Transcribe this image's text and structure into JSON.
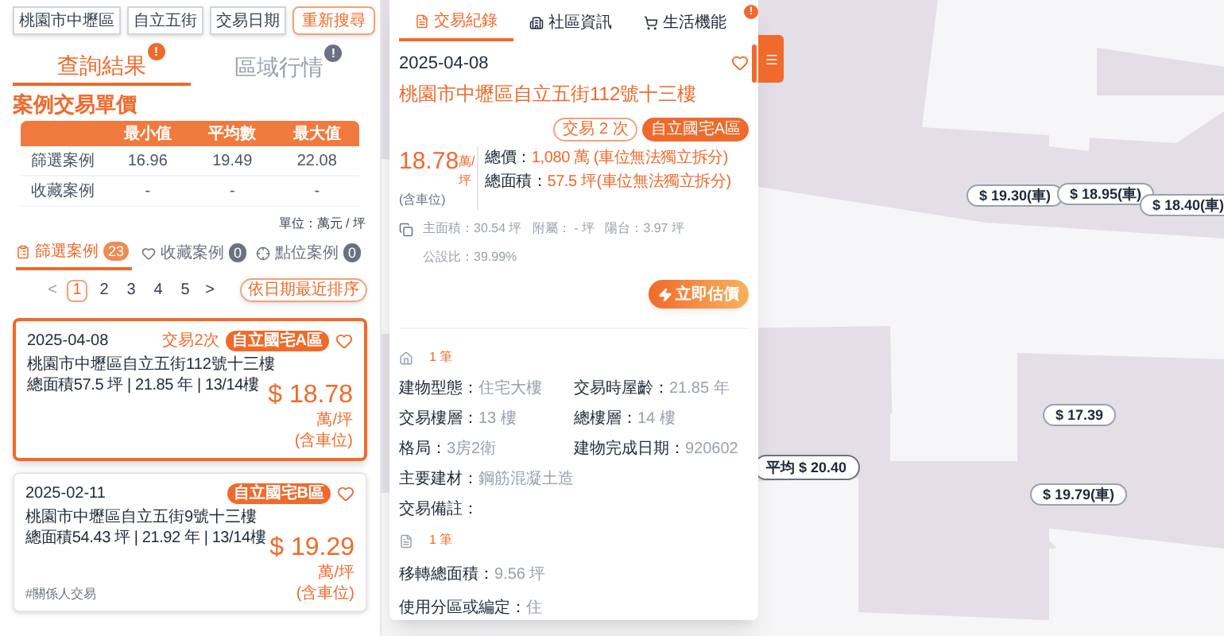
{
  "filters": {
    "chips": [
      "桃園市中壢區",
      "自立五街",
      "交易日期"
    ],
    "search_button": "重新搜尋"
  },
  "result_tabs": [
    {
      "label": "查詢結果",
      "selected": true,
      "badge": "!"
    },
    {
      "label": "區域行情",
      "selected": false,
      "badge": "!"
    }
  ],
  "price_table": {
    "title": "案例交易單價",
    "columns": [
      "最小值",
      "平均數",
      "最大值"
    ],
    "rows": [
      {
        "label": "篩選案例",
        "values": [
          "16.96",
          "19.49",
          "22.08"
        ]
      },
      {
        "label": "收藏案例",
        "values": [
          "-",
          "-",
          "-"
        ]
      }
    ],
    "unit": "單位：萬元 / 坪"
  },
  "case_tabs": [
    {
      "label": "篩選案例",
      "count": "23",
      "selected": true
    },
    {
      "label": "收藏案例",
      "count": "0",
      "selected": false
    },
    {
      "label": "點位案例",
      "count": "0",
      "selected": false
    }
  ],
  "pagination": {
    "prev": "<",
    "pages": [
      {
        "label": "1",
        "selected": true
      },
      {
        "label": "2",
        "selected": false
      },
      {
        "label": "3",
        "selected": false
      },
      {
        "label": "4",
        "selected": false
      },
      {
        "label": "5",
        "selected": false
      }
    ],
    "next": ">",
    "sort_button": "依日期最近排序"
  },
  "cases": [
    {
      "date": "2025-04-08",
      "trades": "交易2次",
      "tag": "自立國宅A區",
      "address": "桃園市中壢區自立五街112號十三樓",
      "summary": "總面積57.5 坪 | 21.85 年 | 13/14樓",
      "price": "$ 18.78",
      "unit": "萬/坪",
      "note": "(含車位)",
      "selected": true
    },
    {
      "date": "2025-02-11",
      "tag": "自立國宅B區",
      "address": "桃園市中壢區自立五街9號十三樓",
      "summary": "總面積54.43 坪 | 21.92 年 | 13/14樓",
      "price": "$ 19.29",
      "unit": "萬/坪",
      "note": "(含車位)",
      "remark": "#關係人交易",
      "selected": false
    }
  ],
  "detail": {
    "tabs": [
      {
        "label": "交易紀錄",
        "selected": true
      },
      {
        "label": "社區資訊",
        "selected": false
      },
      {
        "label": "生活機能",
        "selected": false
      }
    ],
    "badge": "!",
    "date": "2025-04-08",
    "address": "桃園市中壢區自立五街112號十三樓",
    "trades": "交易 2 次",
    "tag": "自立國宅A區",
    "price": "18.78",
    "price_unit": "萬/坪",
    "price_note": "(含車位)",
    "total_price": {
      "label": "總價：",
      "value": "1,080 萬 (車位無法獨立拆分)"
    },
    "total_area": {
      "label": "總面積：",
      "value": "57.5 坪(車位無法獨立拆分)"
    },
    "areas": "主面積：30.54 坪   附屬： - 坪   陽台：3.97 坪",
    "public_ratio": "公設比：39.99%",
    "estimate_button": "立即估價",
    "building_count": "1 筆",
    "building": [
      {
        "label": "建物型態：",
        "value": "住宅大樓"
      },
      {
        "label": "交易時屋齡：",
        "value": "21.85 年"
      },
      {
        "label": "交易樓層：",
        "value": "13 樓"
      },
      {
        "label": "總樓層：",
        "value": "14 樓"
      },
      {
        "label": "格局：",
        "value": "3房2衛"
      },
      {
        "label": "建物完成日期：",
        "value": "920602"
      },
      {
        "label": "主要建材：",
        "value": "鋼筋混凝土造",
        "wide": true
      },
      {
        "label": "交易備註：",
        "wide": true
      }
    ],
    "land_count": "1 筆",
    "land": [
      {
        "label": "移轉總面積：",
        "value": "9.56 坪"
      },
      {
        "label": "使用分區或編定：",
        "value": "住"
      }
    ]
  },
  "map_markers": [
    {
      "text": "$ 19.30(車)",
      "kind": "price"
    },
    {
      "text": "$ 18.95(車)",
      "kind": "price"
    },
    {
      "text": "$ 18.40(車)",
      "kind": "price"
    },
    {
      "text": "$ 17.39",
      "kind": "price"
    },
    {
      "text": "平均 $ 20.40",
      "kind": "average"
    },
    {
      "text": "$ 19.79(車)",
      "kind": "price"
    }
  ]
}
